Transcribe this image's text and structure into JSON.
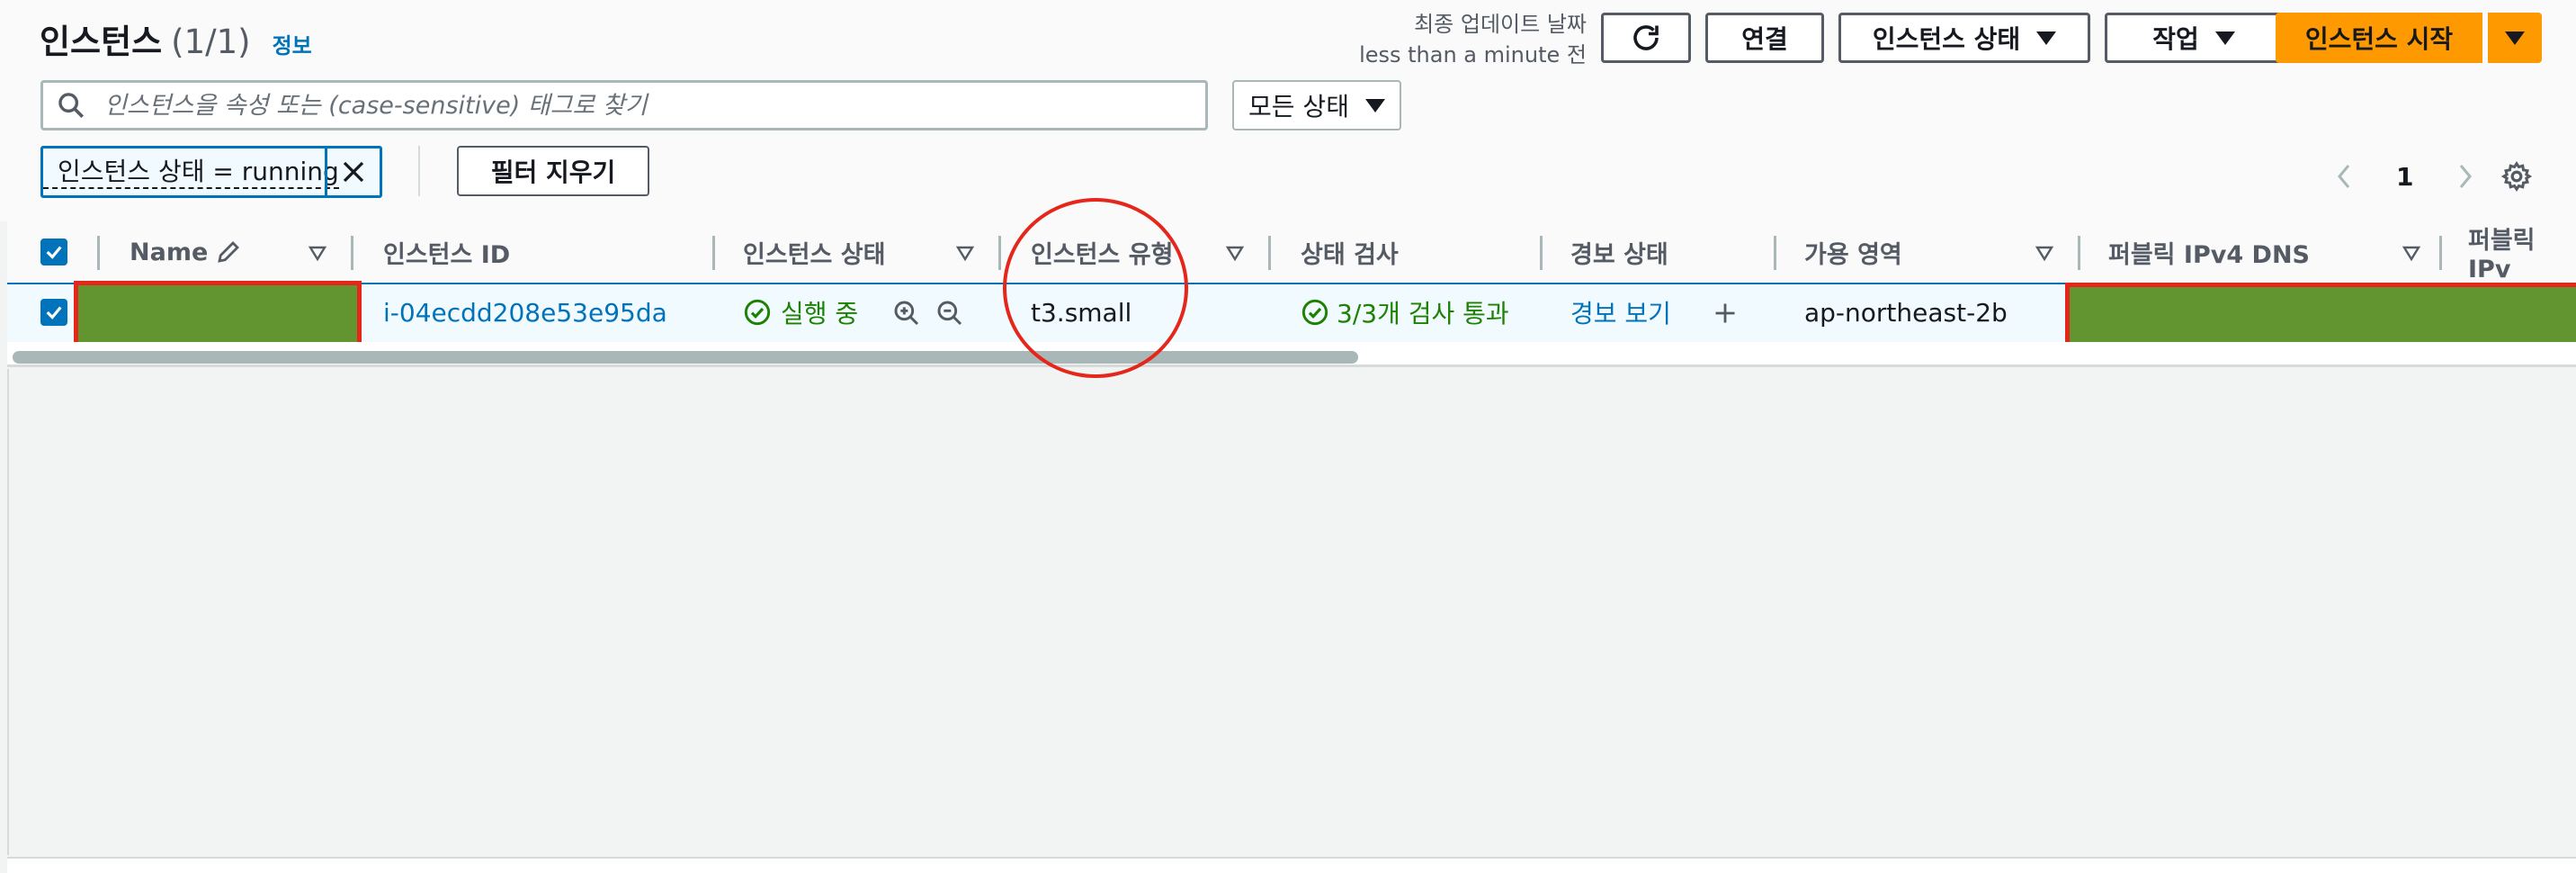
{
  "page": {
    "title": "인스턴스",
    "count": "(1/1)",
    "info_link": "정보",
    "last_updated_label": "최종 업데이트 날짜",
    "last_updated_value": "less than a minute 전"
  },
  "toolbar": {
    "connect": "연결",
    "instance_state": "인스턴스 상태",
    "actions": "작업",
    "launch": "인스턴스 시작"
  },
  "search": {
    "placeholder": "인스턴스을 속성 또는 (case-sensitive) 태그로 찾기",
    "state_filter": "모든 상태"
  },
  "filters": {
    "token": "인스턴스 상태 = running",
    "clear_label": "필터 지우기"
  },
  "pagination": {
    "current_page": "1"
  },
  "table": {
    "columns": {
      "name": "Name",
      "instance_id": "인스턴스 ID",
      "instance_state": "인스턴스 상태",
      "instance_type": "인스턴스 유형",
      "status_check": "상태 검사",
      "alarm_status": "경보 상태",
      "availability_zone": "가용 영역",
      "public_dns": "퍼블릭 IPv4 DNS",
      "public_ip": "퍼블릭 IPv"
    },
    "rows": [
      {
        "instance_id": "i-04ecdd208e53e95da",
        "state": "실행 중",
        "type": "t3.small",
        "status_check": "3/3개 검사 통과",
        "alarm": "경보 보기",
        "az": "ap-northeast-2b"
      }
    ]
  },
  "colors": {
    "accent": "#0073bb",
    "primary_button": "#ff9900",
    "success": "#1d8102",
    "redaction": "#62952f",
    "annotation": "#e5261b"
  }
}
